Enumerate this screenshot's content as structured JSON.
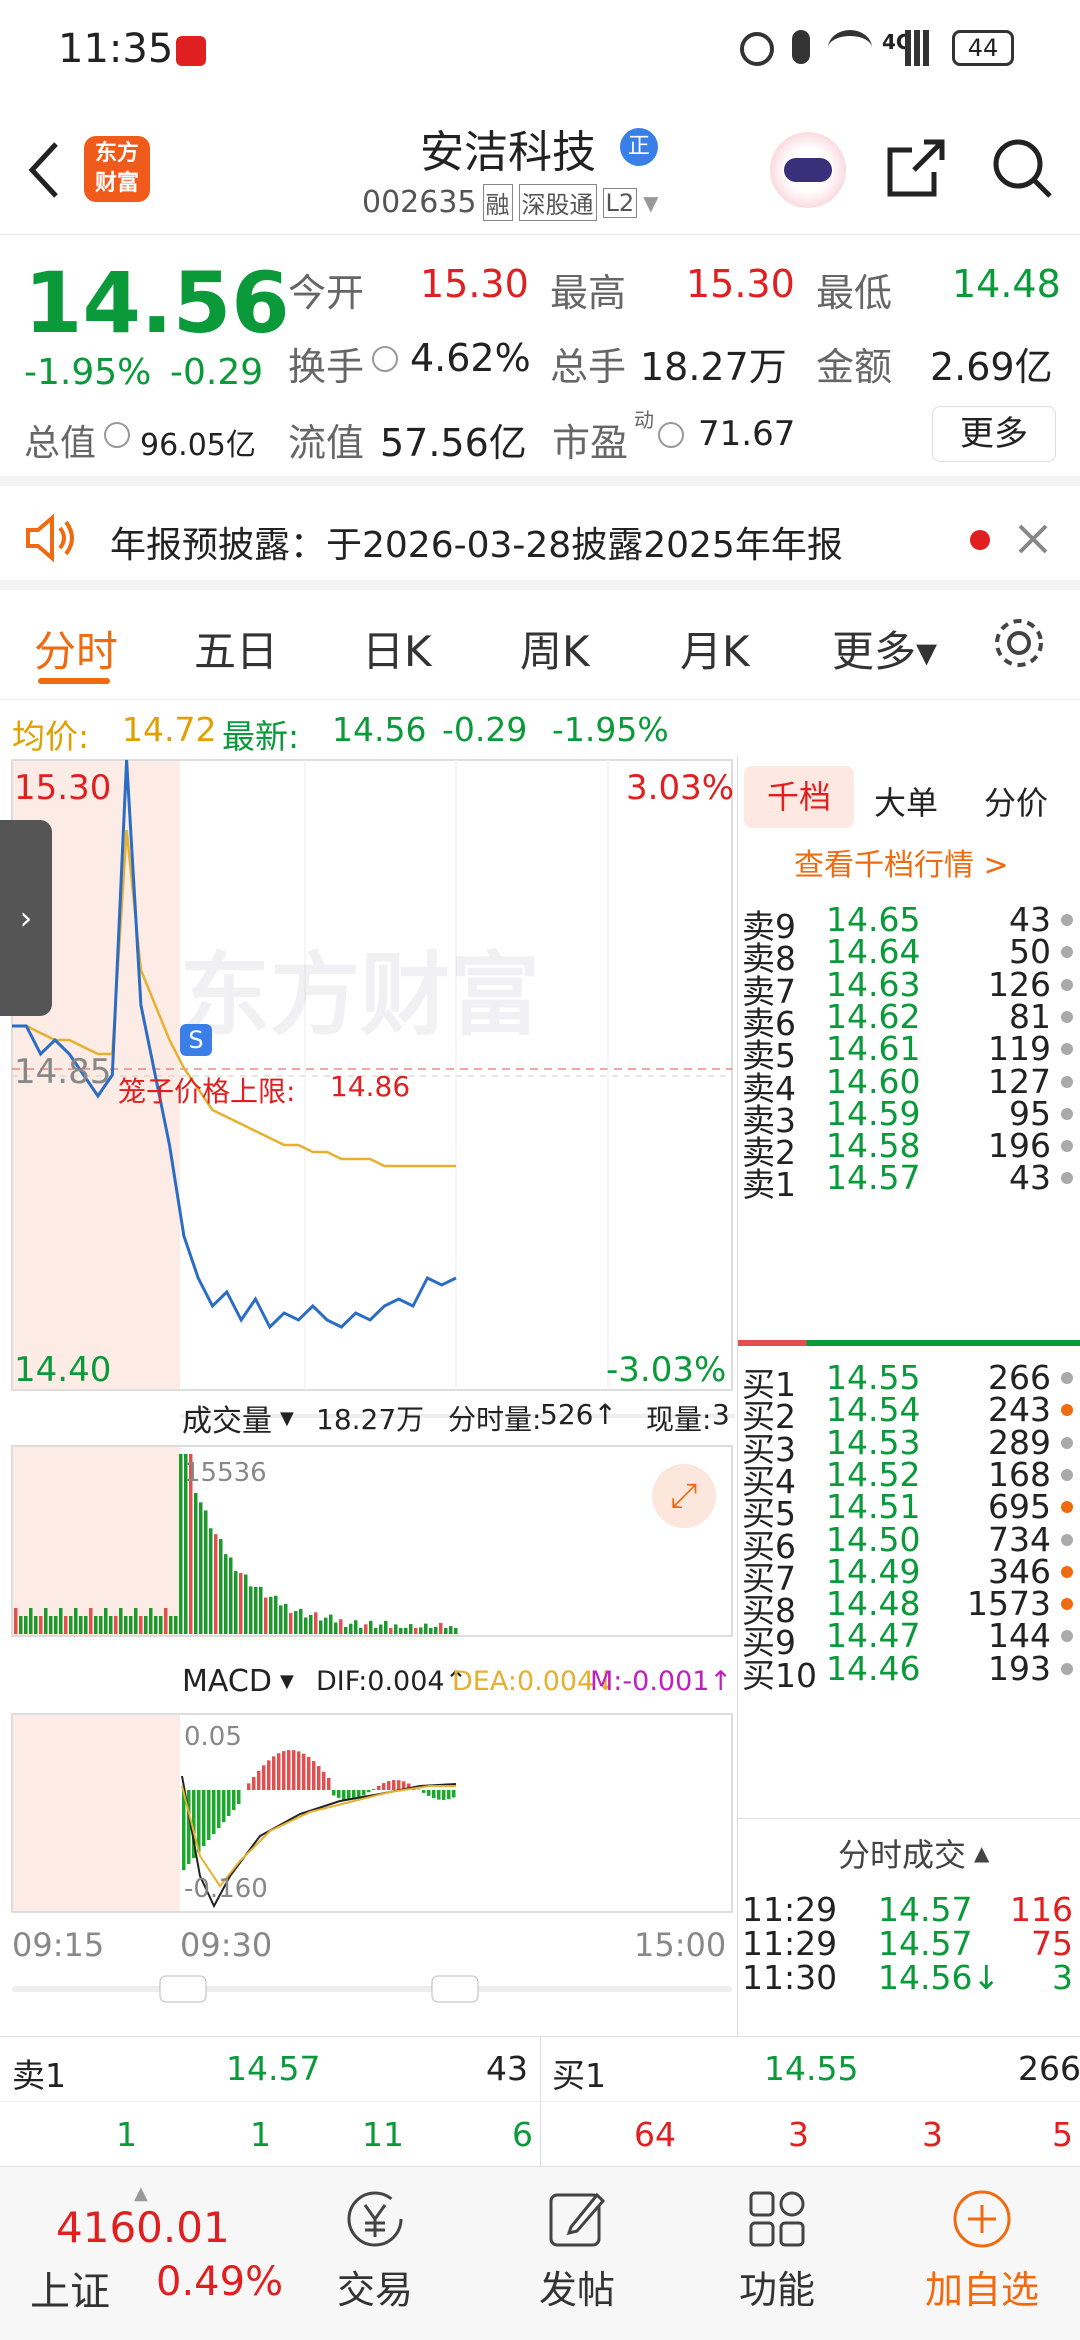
{
  "status_bar": {
    "time": "11:35",
    "battery": "44",
    "network": "4G"
  },
  "header": {
    "logo_line1": "东方",
    "logo_line2": "财富",
    "title": "安洁科技",
    "badge": "正",
    "code": "002635",
    "tag_margin": "融",
    "tag_connect": "深股通",
    "tag_level": "L2"
  },
  "quote": {
    "price": "14.56",
    "change_pct": "-1.95%",
    "change": "-0.29",
    "open_label": "今开",
    "open": "15.30",
    "high_label": "最高",
    "high": "15.30",
    "low_label": "最低",
    "low": "14.48",
    "turnover_label": "换手",
    "turnover": "4.62%",
    "volume_label": "总手",
    "volume": "18.27万",
    "amount_label": "金额",
    "amount": "2.69亿",
    "mcap_label": "总值",
    "mcap": "96.05亿",
    "float_label": "流值",
    "float": "57.56亿",
    "pe_label": "市盈",
    "pe_sup": "动",
    "pe": "71.67",
    "more": "更多"
  },
  "notice": {
    "text": "年报预披露：于2026-03-28披露2025年年报"
  },
  "tabs": [
    "分时",
    "五日",
    "日K",
    "周K",
    "月K",
    "更多",
    "更多▾"
  ],
  "info_line": {
    "avg_label": "均价:",
    "avg": "14.72",
    "latest_label": "最新:",
    "latest": "14.56",
    "chg": "-0.29",
    "pct": "-1.95%"
  },
  "chart": {
    "price_top": "15.30",
    "price_mid": "14.85",
    "price_bottom": "14.40",
    "pct_top": "3.03%",
    "pct_bottom": "-3.03%",
    "limit_label": "笼子价格上限:",
    "limit_value": "14.86",
    "s_mark": "S",
    "watermark": "东方财富",
    "vol_selector": "成交量",
    "vol_total": "18.27万",
    "vol_min_label": "分时量:",
    "vol_min": "526↑",
    "vol_now_label": "现量:",
    "vol_now": "3",
    "vol_peak": "15536",
    "macd_selector": "MACD",
    "dif": "DIF:0.004↑",
    "dea": "DEA:0.004↓",
    "m": "M:-0.001↑",
    "macd_top": "0.05",
    "macd_bottom": "-0.160",
    "time_start": "09:15",
    "time_open": "09:30",
    "time_end": "15:00",
    "chart_data": {
      "type": "line",
      "title": "",
      "xlabel": "",
      "ylabel": "",
      "ylim": [
        14.4,
        15.3
      ],
      "series": [
        {
          "name": "最新",
          "values": [
            14.92,
            14.92,
            14.88,
            14.9,
            14.88,
            14.85,
            14.82,
            14.85,
            15.3,
            14.95,
            14.85,
            14.75,
            14.62,
            14.56,
            14.52,
            14.54,
            14.5,
            14.53,
            14.49,
            14.51,
            14.5,
            14.52,
            14.5,
            14.49,
            14.51,
            14.5,
            14.52,
            14.53,
            14.52,
            14.56,
            14.55,
            14.56
          ]
        },
        {
          "name": "均价",
          "values": [
            14.92,
            14.92,
            14.91,
            14.9,
            14.9,
            14.89,
            14.88,
            14.88,
            15.2,
            15.0,
            14.95,
            14.9,
            14.86,
            14.83,
            14.8,
            14.79,
            14.78,
            14.77,
            14.76,
            14.75,
            14.75,
            14.74,
            14.74,
            14.73,
            14.73,
            14.73,
            14.72,
            14.72,
            14.72,
            14.72,
            14.72,
            14.72
          ]
        }
      ]
    }
  },
  "order_book": {
    "tabs": [
      "千档",
      "大单",
      "分价"
    ],
    "link": "查看千档行情 >",
    "asks": [
      {
        "label": "卖9",
        "price": "14.65",
        "vol": "43"
      },
      {
        "label": "卖8",
        "price": "14.64",
        "vol": "50"
      },
      {
        "label": "卖7",
        "price": "14.63",
        "vol": "126"
      },
      {
        "label": "卖6",
        "price": "14.62",
        "vol": "81"
      },
      {
        "label": "卖5",
        "price": "14.61",
        "vol": "119"
      },
      {
        "label": "卖4",
        "price": "14.60",
        "vol": "127"
      },
      {
        "label": "卖3",
        "price": "14.59",
        "vol": "95"
      },
      {
        "label": "卖2",
        "price": "14.58",
        "vol": "196"
      },
      {
        "label": "卖1",
        "price": "14.57",
        "vol": "43"
      }
    ],
    "bids": [
      {
        "label": "买1",
        "price": "14.55",
        "vol": "266"
      },
      {
        "label": "买2",
        "price": "14.54",
        "vol": "243"
      },
      {
        "label": "买3",
        "price": "14.53",
        "vol": "289"
      },
      {
        "label": "买4",
        "price": "14.52",
        "vol": "168"
      },
      {
        "label": "买5",
        "price": "14.51",
        "vol": "695"
      },
      {
        "label": "买6",
        "price": "14.50",
        "vol": "734"
      },
      {
        "label": "买7",
        "price": "14.49",
        "vol": "346"
      },
      {
        "label": "买8",
        "price": "14.48",
        "vol": "1573"
      },
      {
        "label": "买9",
        "price": "14.47",
        "vol": "144"
      },
      {
        "label": "买10",
        "price": "14.46",
        "vol": "193"
      }
    ],
    "ticks_title": "分时成交",
    "ticks": [
      {
        "time": "11:29",
        "price": "14.57",
        "vol": "116"
      },
      {
        "time": "11:29",
        "price": "14.57",
        "vol": "75"
      },
      {
        "time": "11:30",
        "price": "14.56↓",
        "vol": "3"
      }
    ]
  },
  "summary": {
    "ask_label": "卖1",
    "ask_price": "14.57",
    "ask_vol": "43",
    "bid_label": "买1",
    "bid_price": "14.55",
    "bid_vol": "266",
    "left_counts": [
      "1",
      "1",
      "11",
      "6"
    ],
    "right_counts": [
      "64",
      "3",
      "3",
      "5"
    ]
  },
  "bottom_nav": {
    "index_value": "4160.01",
    "index_name": "上证",
    "index_pct": "0.49%",
    "trade": "交易",
    "post": "发帖",
    "func": "功能",
    "watch": "加自选"
  }
}
